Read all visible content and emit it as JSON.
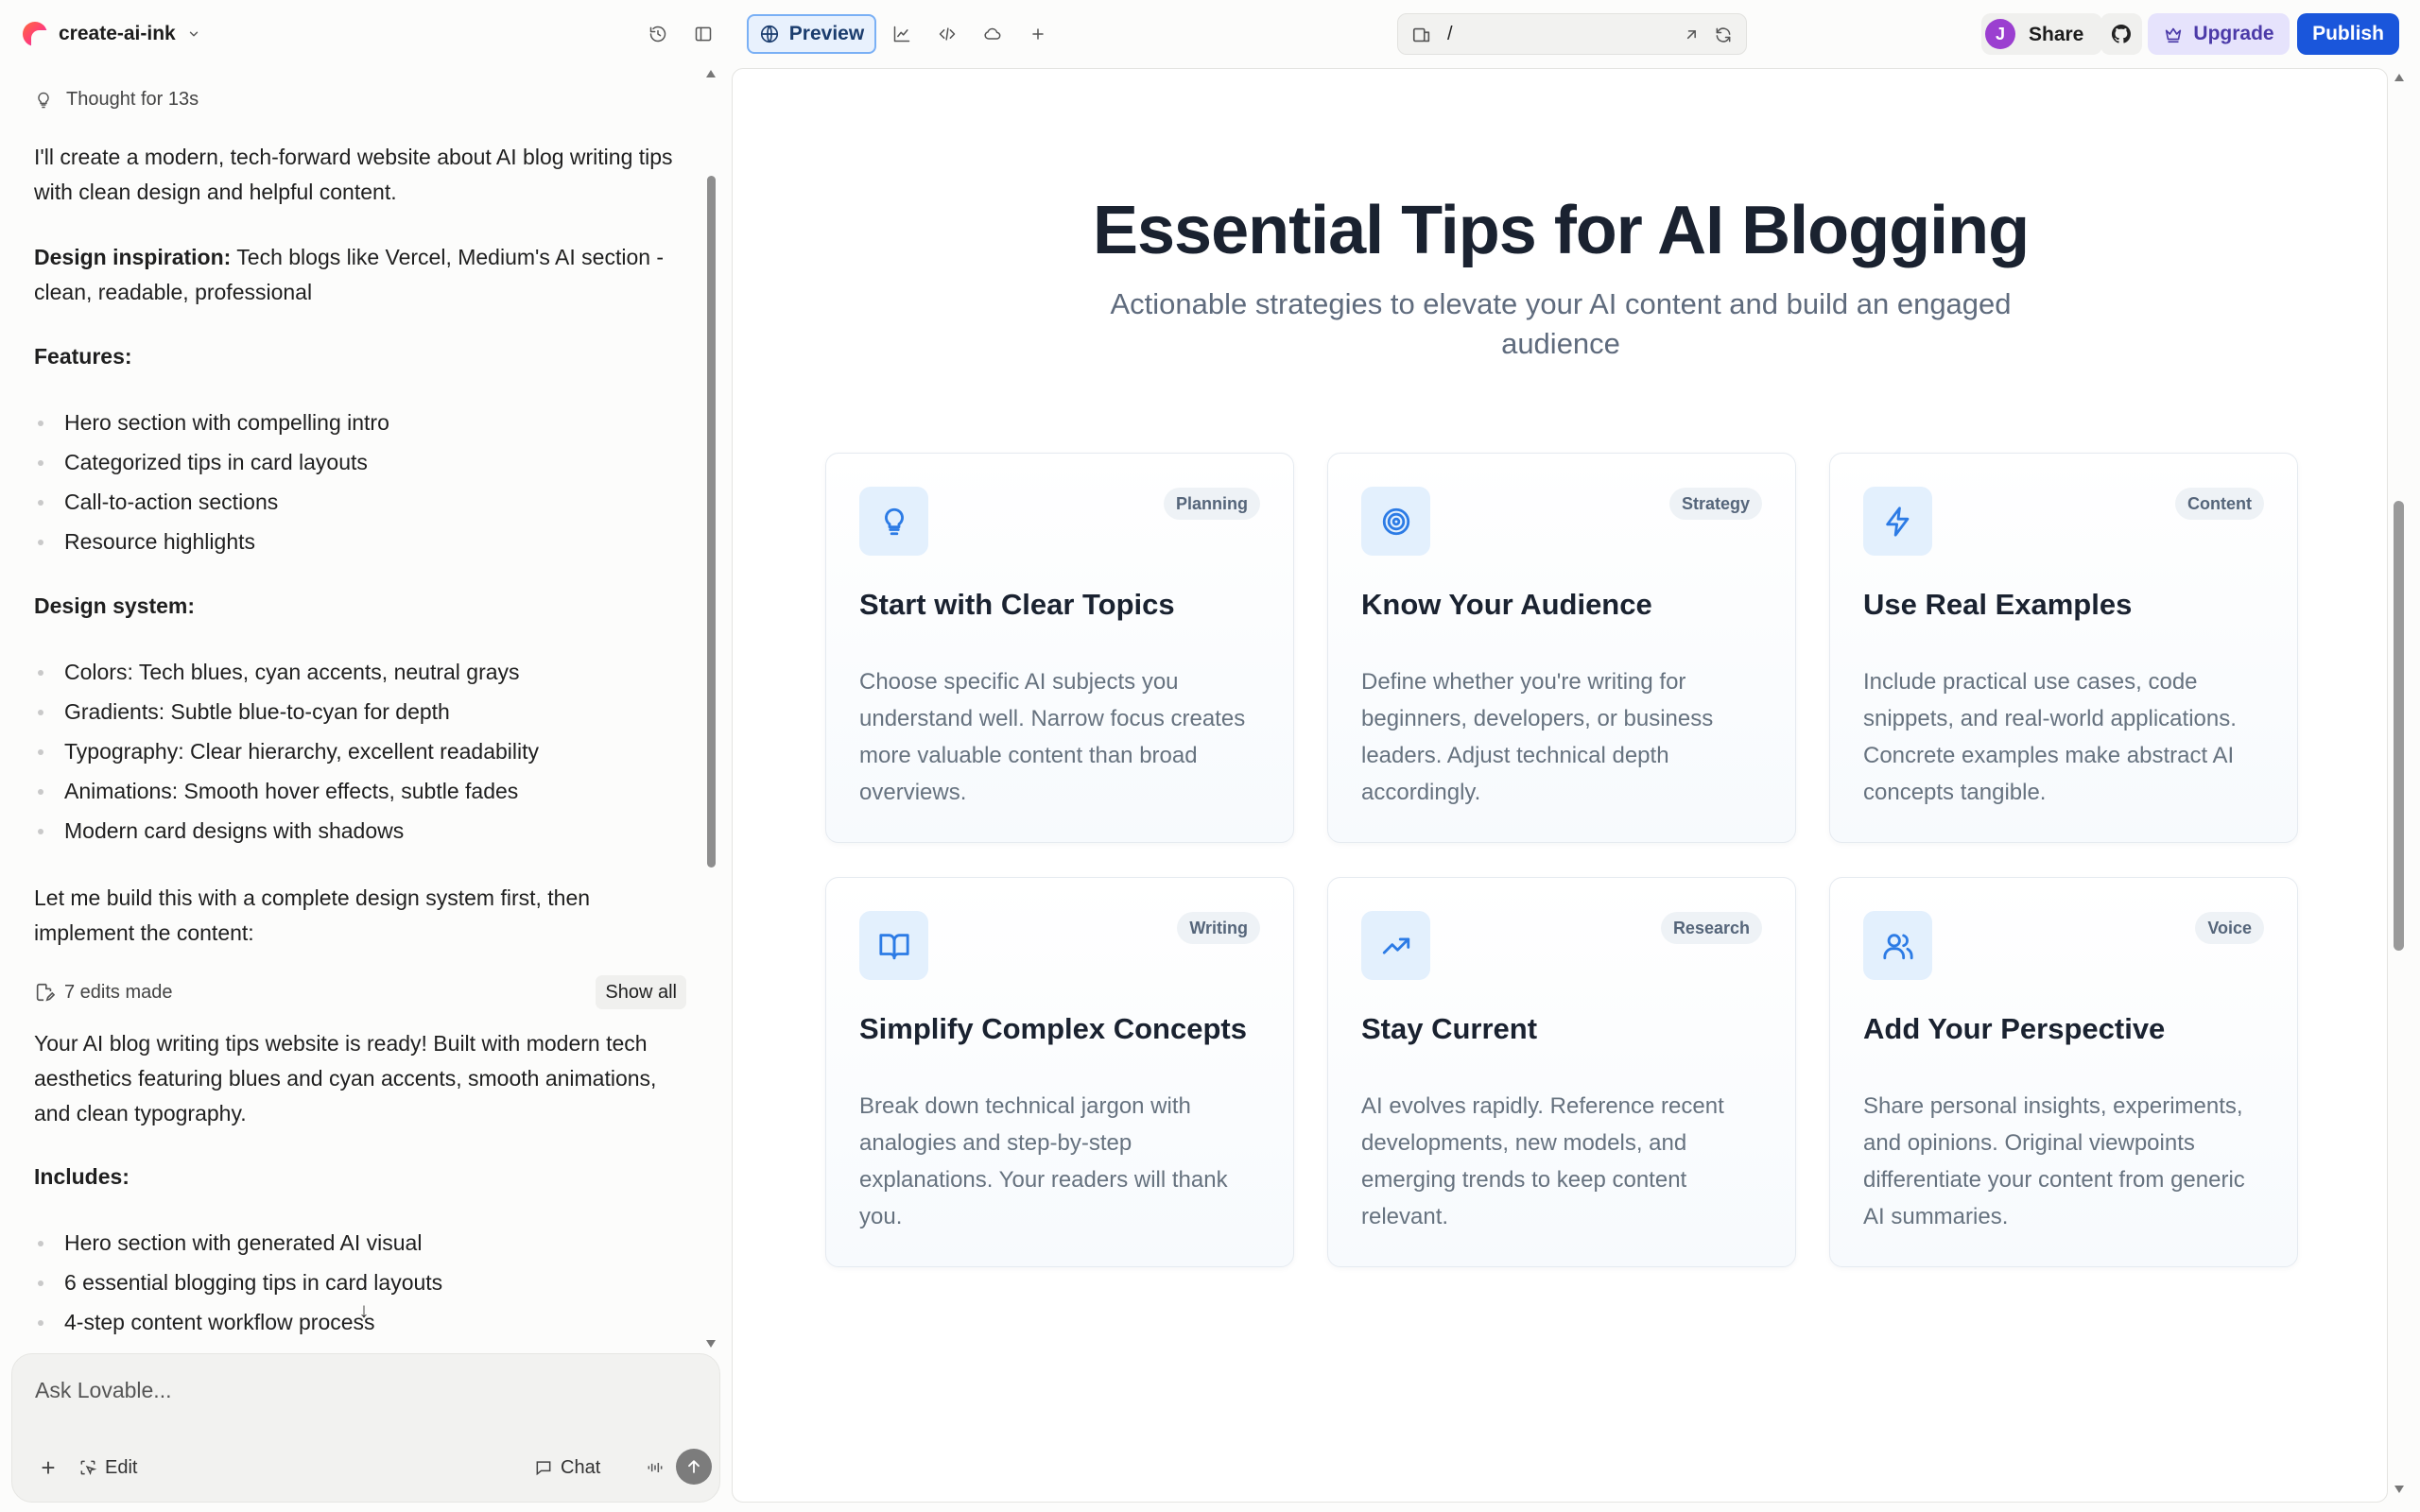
{
  "topbar": {
    "project_name": "create-ai-ink",
    "preview_label": "Preview",
    "url_path": "/",
    "avatar_initial": "J",
    "share_label": "Share",
    "upgrade_label": "Upgrade",
    "publish_label": "Publish",
    "icons": [
      "history-icon",
      "sidebar-toggle-icon",
      "globe-icon",
      "analytics-icon",
      "code-icon",
      "cloud-icon",
      "plus-icon",
      "device-icon",
      "open-external-icon",
      "refresh-icon",
      "github-icon",
      "crown-icon"
    ]
  },
  "chat": {
    "thought_label": "Thought for 13s",
    "intro": "I'll create a modern, tech-forward website about AI blog writing tips with clean design and helpful content.",
    "inspiration_label": "Design inspiration:",
    "inspiration_text": " Tech blogs like Vercel, Medium's AI section - clean, readable, professional",
    "features_heading": "Features:",
    "features": [
      "Hero section with compelling intro",
      "Categorized tips in card layouts",
      "Call-to-action sections",
      "Resource highlights"
    ],
    "design_system_heading": "Design system:",
    "design_system": [
      "Colors: Tech blues, cyan accents, neutral grays",
      "Gradients: Subtle blue-to-cyan for depth",
      "Typography: Clear hierarchy, excellent readability",
      "Animations: Smooth hover effects, subtle fades",
      "Modern card designs with shadows"
    ],
    "build_note": "Let me build this with a complete design system first, then implement the content:",
    "edits_label": "7 edits made",
    "show_all_label": "Show all",
    "ready_message": "Your AI blog writing tips website is ready! Built with modern tech aesthetics featuring blues and cyan accents, smooth animations, and clean typography.",
    "includes_heading": "Includes:",
    "includes": [
      "Hero section with generated AI visual",
      "6 essential blogging tips in card layouts",
      "4-step content workflow process"
    ],
    "composer_placeholder": "Ask Lovable...",
    "edit_label": "Edit",
    "chat_label": "Chat"
  },
  "preview": {
    "hero_title": "Essential Tips for AI Blogging",
    "hero_subtitle": "Actionable strategies to elevate your AI content and build an engaged audience",
    "accent_color": "#2c7be5",
    "cards": [
      {
        "icon": "lightbulb-icon",
        "tag": "Planning",
        "title": "Start with Clear Topics",
        "desc": "Choose specific AI subjects you understand well. Narrow focus creates more valuable content than broad overviews."
      },
      {
        "icon": "target-icon",
        "tag": "Strategy",
        "title": "Know Your Audience",
        "desc": "Define whether you're writing for beginners, developers, or business leaders. Adjust technical depth accordingly."
      },
      {
        "icon": "zap-icon",
        "tag": "Content",
        "title": "Use Real Examples",
        "desc": "Include practical use cases, code snippets, and real-world applications. Concrete examples make abstract AI concepts tangible."
      },
      {
        "icon": "book-open-icon",
        "tag": "Writing",
        "title": "Simplify Complex Concepts",
        "desc": "Break down technical jargon with analogies and step-by-step explanations. Your readers will thank you."
      },
      {
        "icon": "trending-up-icon",
        "tag": "Research",
        "title": "Stay Current",
        "desc": "AI evolves rapidly. Reference recent developments, new models, and emerging trends to keep content relevant."
      },
      {
        "icon": "users-icon",
        "tag": "Voice",
        "title": "Add Your Perspective",
        "desc": "Share personal insights, experiments, and opinions. Original viewpoints differentiate your content from generic AI summaries."
      }
    ]
  }
}
